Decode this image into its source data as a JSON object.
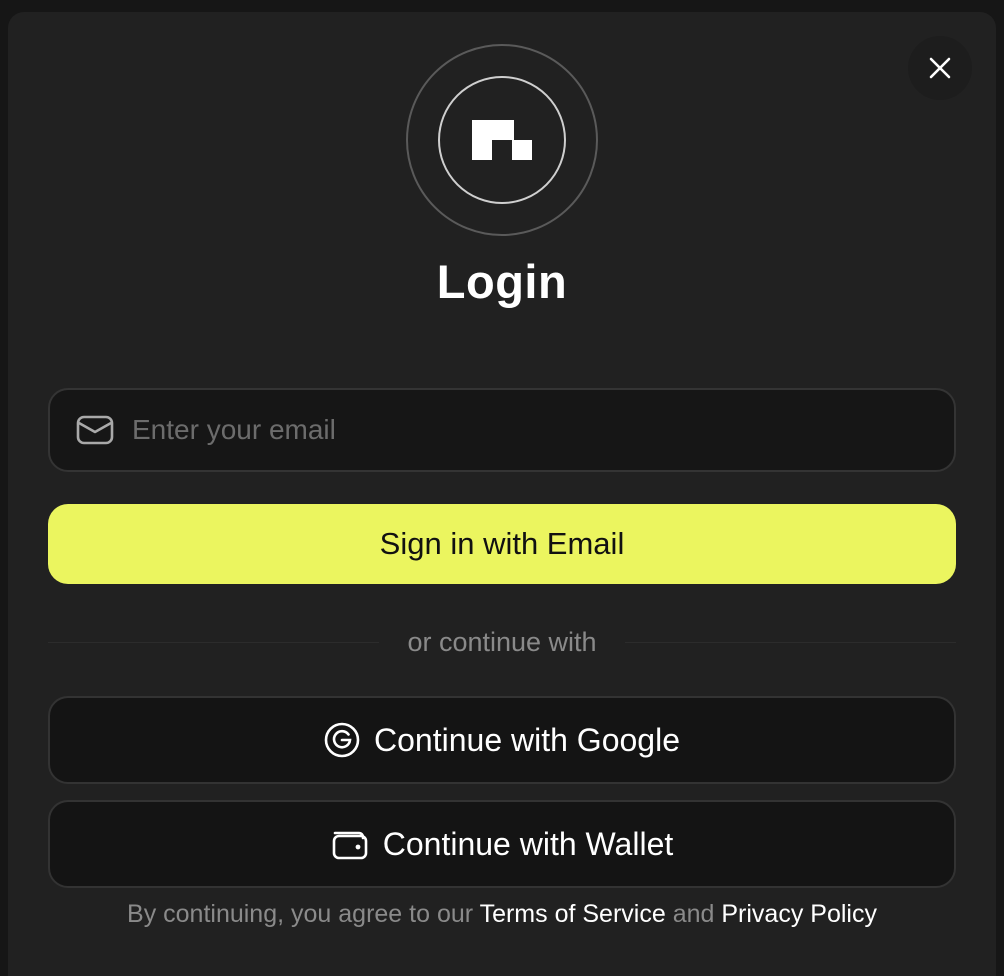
{
  "modal": {
    "title": "Login",
    "close_icon": "close-icon",
    "logo_icon": "brand-logo"
  },
  "email": {
    "placeholder": "Enter your email",
    "value": "",
    "icon": "mail-icon"
  },
  "primary_button": {
    "label": "Sign in with Email"
  },
  "divider": {
    "text": "or continue with"
  },
  "social": [
    {
      "label": "Continue with Google",
      "icon": "google-icon"
    },
    {
      "label": "Continue with Wallet",
      "icon": "wallet-icon"
    }
  ],
  "footer": {
    "prefix": "By continuing, you agree to our",
    "terms_link": "Terms of Service",
    "conjunction": "and",
    "privacy_link": "Privacy Policy"
  },
  "colors": {
    "background": "#161616",
    "modal": "#212121",
    "accent": "#ebf55f",
    "muted_text": "#8a8a8a"
  }
}
